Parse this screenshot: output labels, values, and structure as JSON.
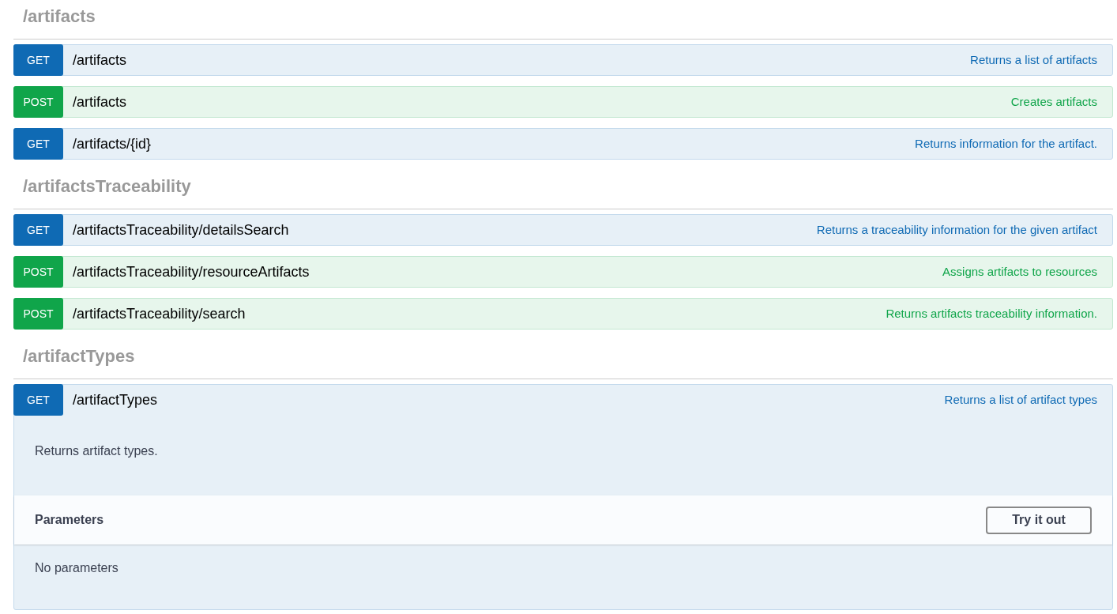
{
  "sections": [
    {
      "title": "/artifacts",
      "operations": [
        {
          "method": "GET",
          "path": "/artifacts",
          "summary": "Returns a list of artifacts",
          "expanded": false
        },
        {
          "method": "POST",
          "path": "/artifacts",
          "summary": "Creates artifacts",
          "expanded": false
        },
        {
          "method": "GET",
          "path": "/artifacts/{id}",
          "summary": "Returns information for the artifact.",
          "expanded": false
        }
      ]
    },
    {
      "title": "/artifactsTraceability",
      "operations": [
        {
          "method": "GET",
          "path": "/artifactsTraceability/detailsSearch",
          "summary": "Returns a traceability information for the given artifact",
          "expanded": false
        },
        {
          "method": "POST",
          "path": "/artifactsTraceability/resourceArtifacts",
          "summary": "Assigns artifacts to resources",
          "expanded": false
        },
        {
          "method": "POST",
          "path": "/artifactsTraceability/search",
          "summary": "Returns artifacts traceability information.",
          "expanded": false
        }
      ]
    },
    {
      "title": "/artifactTypes",
      "operations": [
        {
          "method": "GET",
          "path": "/artifactTypes",
          "summary": "Returns a list of artifact types",
          "expanded": true,
          "description": "Returns artifact types.",
          "parameters_title": "Parameters",
          "try_button": "Try it out",
          "parameters_text": "No parameters"
        }
      ]
    }
  ]
}
